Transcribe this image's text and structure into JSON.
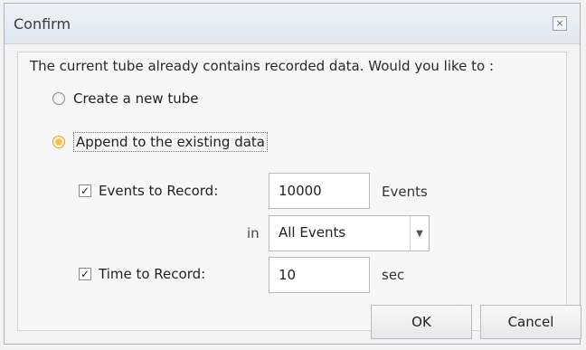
{
  "dialog": {
    "title": "Confirm",
    "close_icon": "close-icon",
    "prompt": "The current tube already contains recorded data. Would you like to :",
    "options": [
      {
        "label": "Create a new tube",
        "selected": false
      },
      {
        "label": "Append to the existing data",
        "selected": true
      }
    ],
    "events": {
      "label": "Events to Record:",
      "checked": true,
      "value": "10000",
      "unit": "Events"
    },
    "filter": {
      "in_label": "in",
      "selected": "All Events"
    },
    "time": {
      "label": "Time to Record:",
      "checked": true,
      "value": "10",
      "unit": "sec"
    },
    "buttons": {
      "ok": "OK",
      "cancel": "Cancel"
    },
    "colors": {
      "selected_radio": "#f4c24a",
      "title_bar": "#e1e7ef"
    }
  }
}
